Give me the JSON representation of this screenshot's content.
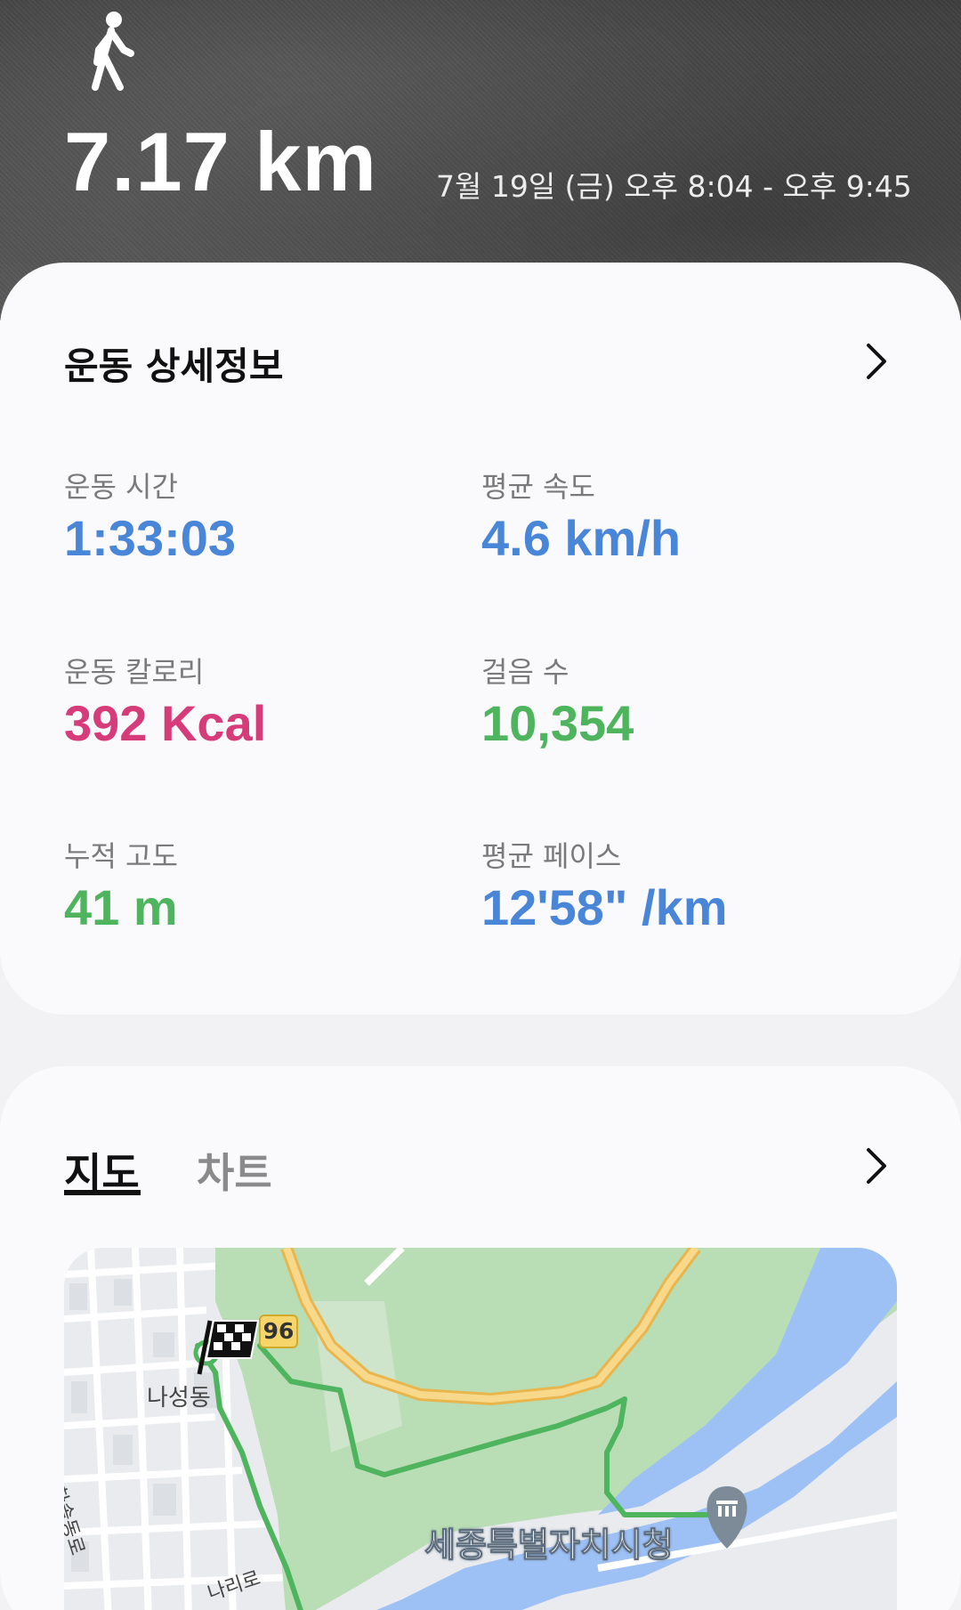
{
  "header": {
    "activity_icon": "walk-icon",
    "distance": "7.17 km",
    "datetime": "7월 19일 (금) 오후 8:04 - 오후 9:45"
  },
  "details": {
    "title": "운동 상세정보",
    "metrics": [
      {
        "label": "운동 시간",
        "value": "1:33:03",
        "color": "#4a86d8"
      },
      {
        "label": "평균 속도",
        "value": "4.6 km/h",
        "color": "#4a86d8"
      },
      {
        "label": "운동 칼로리",
        "value": "392 Kcal",
        "color": "#d63c7a"
      },
      {
        "label": "걸음 수",
        "value": "10,354",
        "color": "#4fb45e"
      },
      {
        "label": "누적 고도",
        "value": "41 m",
        "color": "#4fb45e"
      },
      {
        "label": "평균 페이스",
        "value": "12'58\" /km",
        "color": "#4a86d8"
      }
    ]
  },
  "map_section": {
    "tabs": [
      {
        "label": "지도",
        "active": true
      },
      {
        "label": "차트",
        "active": false
      }
    ],
    "map": {
      "road_number": "96",
      "labels": {
        "district": "나성동",
        "road_1": "한솔동로",
        "road_2": "나리로",
        "city_hall": "세종특별자치시청"
      }
    }
  },
  "colors": {
    "blue_value": "#4a86d8",
    "pink_value": "#d63c7a",
    "green_value": "#4fb45e",
    "route": "#4fb45e",
    "river": "#9ec1f5",
    "park": "#b9ddb5"
  }
}
